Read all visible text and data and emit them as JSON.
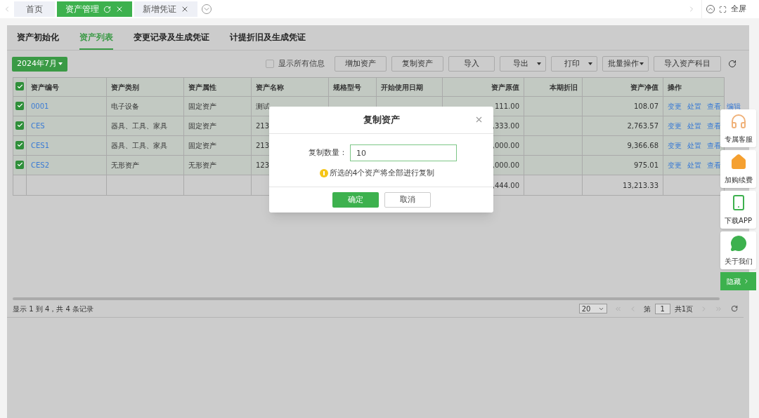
{
  "top_tabs": [
    {
      "label": "首页",
      "selected": false,
      "closable": false
    },
    {
      "label": "资产管理",
      "selected": true,
      "closable": true
    },
    {
      "label": "新增凭证",
      "selected": false,
      "closable": true
    }
  ],
  "fullscreen": "全屏",
  "sub_tabs": [
    {
      "label": "资产初始化",
      "selected": false
    },
    {
      "label": "资产列表",
      "selected": true
    },
    {
      "label": "变更记录及生成凭证",
      "selected": false
    },
    {
      "label": "计提折旧及生成凭证",
      "selected": false
    }
  ],
  "period": "2024年7月",
  "show_all": {
    "label": "显示所有信息",
    "checked": false
  },
  "toolbar": [
    {
      "label": "增加资产",
      "kind": "button"
    },
    {
      "label": "复制资产",
      "kind": "button"
    },
    {
      "label": "导入",
      "kind": "button"
    },
    {
      "label": "导出",
      "kind": "dropdown"
    },
    {
      "label": "打印",
      "kind": "dropdown"
    },
    {
      "label": "批量操作",
      "kind": "menu"
    },
    {
      "label": "导入资产科目",
      "kind": "button"
    }
  ],
  "table": {
    "all_checked": true,
    "columns": [
      "资产编号",
      "资产类别",
      "资产属性",
      "资产名称",
      "规格型号",
      "开始使用日期",
      "资产原值",
      "本期折旧",
      "资产净值",
      "操作"
    ],
    "rows": [
      {
        "checked": true,
        "cells": [
          "0001",
          "电子设备",
          "固定资产",
          "测试",
          "",
          "",
          "111.00",
          "",
          "108.07"
        ],
        "actions": [
          "变更",
          "处置",
          "查看",
          "编辑"
        ]
      },
      {
        "checked": true,
        "cells": [
          "CES",
          "器具、工具、家具",
          "固定资产",
          "213",
          "",
          "",
          ",333.00",
          "",
          "2,763.57"
        ],
        "actions": [
          "变更",
          "处置",
          "查看"
        ]
      },
      {
        "checked": true,
        "cells": [
          "CES1",
          "器具、工具、家具",
          "固定资产",
          "213",
          "",
          "",
          ",000.00",
          "",
          "9,366.68"
        ],
        "actions": [
          "变更",
          "处置",
          "查看"
        ]
      },
      {
        "checked": true,
        "cells": [
          "CES2",
          "无形资产",
          "无形资产",
          "123",
          "",
          "",
          ",000.00",
          "",
          "975.01"
        ],
        "actions": [
          "变更",
          "处置",
          "查看"
        ]
      }
    ],
    "totals": {
      "original_value": ",444.00",
      "net_value": "13,213.33"
    }
  },
  "footer": {
    "summary": "显示 1 到 4，共 4 条记录",
    "page_size": "20",
    "page_prefix": "第",
    "page": "1",
    "page_total": "共1页"
  },
  "dialog": {
    "title": "复制资产",
    "field_label": "复制数量：",
    "field_value": "10",
    "notice": "所选的4个资产将全部进行复制",
    "buttons": [
      {
        "label": "确定",
        "kind": "primary"
      },
      {
        "label": "取消",
        "kind": "secondary"
      }
    ]
  },
  "side_panel": {
    "items": [
      {
        "label": "专属客服",
        "kind": "headset"
      },
      {
        "label": "加购续费",
        "kind": "renew"
      },
      {
        "label": "下载APP",
        "kind": "phone"
      },
      {
        "label": "关于我们",
        "kind": "chat"
      }
    ],
    "hide": "隐藏"
  }
}
